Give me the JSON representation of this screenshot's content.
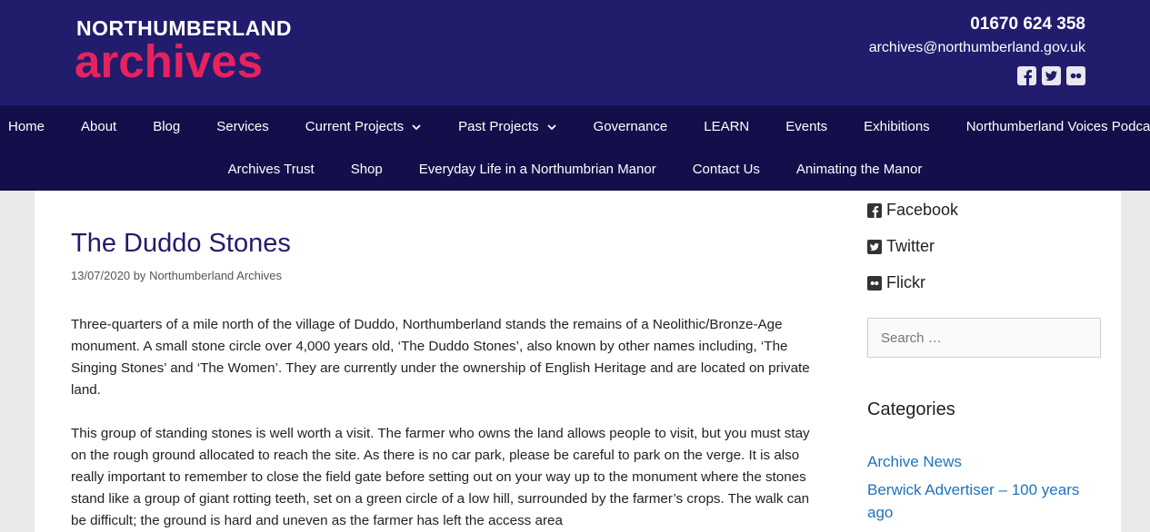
{
  "header": {
    "logo_top": "NORTHUMBERLAND",
    "logo_bottom": "archives",
    "phone": "01670 624 358",
    "email": "archives@northumberland.gov.uk",
    "social_icons": [
      "facebook-icon",
      "twitter-icon",
      "flickr-icon"
    ]
  },
  "nav": {
    "row1": [
      "Home",
      "About",
      "Blog",
      "Services",
      "Current Projects",
      "Past Projects",
      "Governance",
      "LEARN",
      "Events",
      "Exhibitions",
      "Northumberland Voices Podcasts"
    ],
    "row2": [
      "Archives Trust",
      "Shop",
      "Everyday Life in a Northumbrian Manor",
      "Contact Us",
      "Animating the Manor"
    ]
  },
  "post": {
    "title": "The Duddo Stones",
    "date": "13/07/2020",
    "by": "by",
    "author": "Northumberland Archives",
    "p1": "Three-quarters of a mile north of the village of Duddo, Northumberland stands the remains of a Neolithic/Bronze-Age monument.  A small stone circle over 4,000 years old, ‘The Duddo Stones’, also known by other names including, ‘The Singing Stones’ and ‘The Women’. They are currently under the ownership of English Heritage and are located on private land.",
    "p2": "This group of standing stones is well worth a visit. The farmer who owns the land allows people to visit, but you must stay on the rough ground allocated to reach the site. As there is no car park, please be careful to park on the verge. It is also really important to remember to close the field gate before setting out on your way up to the monument where the stones stand like a group of giant rotting teeth, set on a green circle of a low hill, surrounded by the farmer’s crops. The walk can be difficult; the ground is hard and uneven as the farmer has left the access area"
  },
  "sidebar": {
    "social": [
      "Facebook",
      "Twitter",
      "Flickr"
    ],
    "search_placeholder": "Search …",
    "categories_title": "Categories",
    "categories": [
      "Archive News",
      "Berwick Advertiser – 100 years ago"
    ]
  },
  "colors": {
    "header_bg": "#221c6d",
    "nav_bg": "#140f4a",
    "logo_accent": "#e8225f",
    "link": "#1e73be"
  }
}
